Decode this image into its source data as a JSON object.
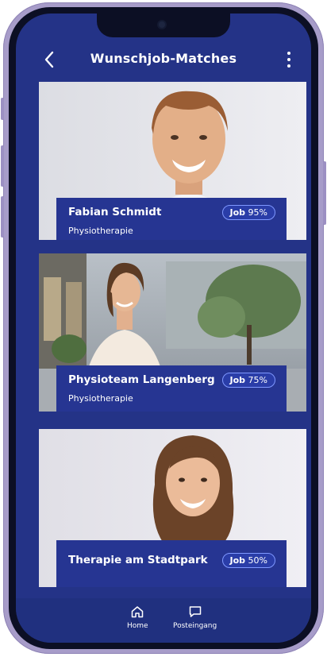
{
  "header": {
    "title": "Wunschjob-Matches"
  },
  "matches": [
    {
      "name": "Fabian Schmidt",
      "category": "Physiotherapie",
      "badge_prefix": "Job",
      "badge_value": "95%"
    },
    {
      "name": "Physioteam Langenberg",
      "category": "Physiotherapie",
      "badge_prefix": "Job",
      "badge_value": "75%"
    },
    {
      "name": "Therapie am Stadtpark",
      "category": "",
      "badge_prefix": "Job",
      "badge_value": "50%"
    }
  ],
  "bottom_nav": {
    "home_label": "Home",
    "inbox_label": "Posteingang"
  },
  "colors": {
    "screen_background": "#243387",
    "card_info": "#263592",
    "badge_border": "#7f98ff"
  },
  "icons": [
    "back-arrow-icon",
    "more-vertical-icon",
    "home-icon",
    "chat-bubble-icon"
  ]
}
